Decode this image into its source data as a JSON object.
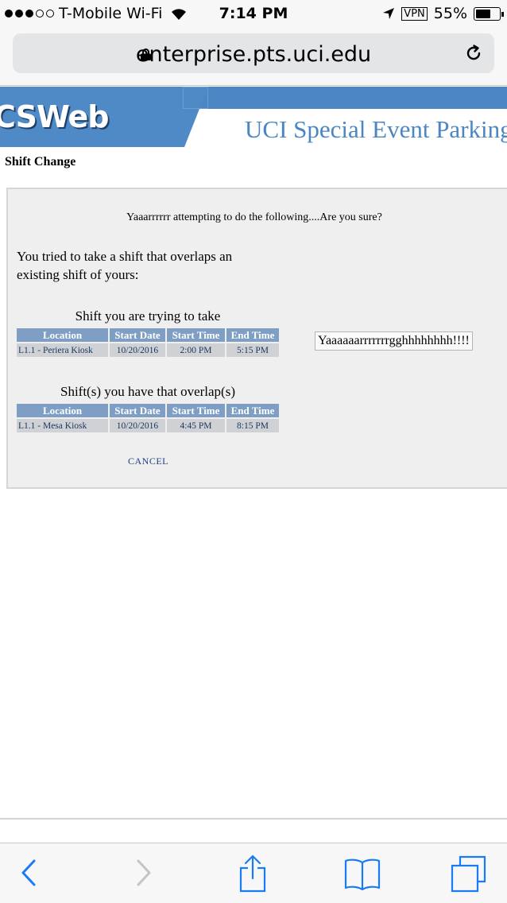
{
  "status_bar": {
    "carrier": "T-Mobile Wi-Fi",
    "time": "7:14 PM",
    "vpn": "VPN",
    "battery": "55%"
  },
  "browser": {
    "url": "enterprise.pts.uci.edu"
  },
  "site": {
    "logo": "CSWeb",
    "title": "UCI Special Event Parking"
  },
  "page": {
    "heading": "Shift Change",
    "warning": "Yaaarrrrrr attempting to do the following....Are you sure?",
    "message": "You tried to take a shift that overlaps an existing shift of yours:",
    "confirm_button": "Yaaaaaarrrrrrrgghhhhhhhh!!!!",
    "cancel_link": "CANCEL"
  },
  "tables": {
    "columns": [
      "Location",
      "Start Date",
      "Start Time",
      "End Time"
    ],
    "trying": {
      "caption": "Shift you are trying to take",
      "rows": [
        {
          "location": "L1.1 - Periera Kiosk",
          "start_date": "10/20/2016",
          "start_time": "2:00 PM",
          "end_time": "5:15 PM"
        }
      ]
    },
    "overlap": {
      "caption": "Shift(s) you have that overlap(s)",
      "rows": [
        {
          "location": "L1.1 - Mesa Kiosk",
          "start_date": "10/20/2016",
          "start_time": "4:45 PM",
          "end_time": "8:15 PM"
        }
      ]
    }
  },
  "icons": {
    "toolbar": [
      "back-icon",
      "forward-icon",
      "share-icon",
      "bookmarks-icon",
      "tabs-icon"
    ],
    "accent": "#1a7cf5"
  }
}
